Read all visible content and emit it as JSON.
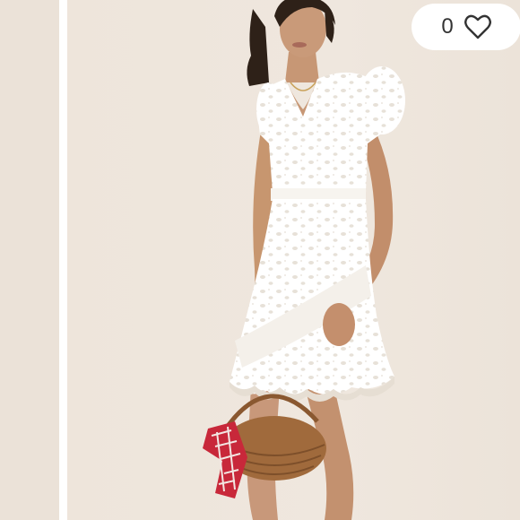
{
  "listing": {
    "like_count": "0",
    "like_icon": "heart-outline-icon",
    "colors": {
      "background": "#ede4da",
      "divider": "#ffffff",
      "dress": "#ffffff",
      "skin": "#c79775",
      "hair": "#2e2118",
      "basket": "#a06a3c",
      "scarf_red": "#c8283a"
    }
  }
}
